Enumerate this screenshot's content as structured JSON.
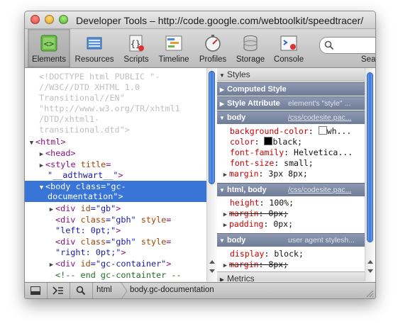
{
  "window": {
    "title": "Developer Tools – http://code.google.com/webtoolkit/speedtracer/"
  },
  "toolbar": {
    "items": [
      {
        "label": "Elements",
        "icon": "elements-icon",
        "active": true
      },
      {
        "label": "Resources",
        "icon": "resources-icon"
      },
      {
        "label": "Scripts",
        "icon": "scripts-icon"
      },
      {
        "label": "Timeline",
        "icon": "timeline-icon"
      },
      {
        "label": "Profiles",
        "icon": "profiles-icon"
      },
      {
        "label": "Storage",
        "icon": "storage-icon"
      },
      {
        "label": "Console",
        "icon": "console-icon"
      }
    ],
    "search_label": "Sea"
  },
  "dom_tree": {
    "doctype_lines": [
      "<!DOCTYPE html PUBLIC \"-",
      "//W3C//DTD XHTML 1.0",
      "Transitional//EN\"",
      "\"http://www.w3.org/TR/xhtml1",
      "/DTD/xhtml1-",
      "transitional.dtd\">"
    ],
    "html_tag": "<html>",
    "head_tag": "<head>",
    "style_tag": "<style",
    "style_attr": "title",
    "style_eq": "=",
    "style_val": "\"__adthwart__\"",
    "style_close": ">",
    "body_open": "<body",
    "body_attr": "class",
    "body_eq": "=",
    "body_val_1": "\"gc-",
    "body_val_2": "documentation\"",
    "body_close": ">",
    "div_gb_open": "<div",
    "div_gb_attr": "id",
    "div_gb_val": "=\"gb\"",
    "div_gb_close": ">",
    "div_gbh1_open": "<div",
    "div_gbh1_attr": "class",
    "div_gbh1_val": "=\"gbh\"",
    "div_gbh1_attr2": "style",
    "div_gbh1_eq2": "=",
    "div_gbh1_val2": "\"left: 0pt;\"",
    "div_gbh1_close": ">",
    "div_gbh2_open": "<div",
    "div_gbh2_attr": "class",
    "div_gbh2_val": "=\"gbh\"",
    "div_gbh2_attr2": "style",
    "div_gbh2_eq2": "=",
    "div_gbh2_val2": "\"right: 0pt;\"",
    "div_gbh2_close": ">",
    "div_gcc_open": "<div",
    "div_gcc_attr": "id",
    "div_gcc_val": "=\"gc-container\"",
    "div_gcc_close": ">",
    "comment": "<!-- end gc-containter --"
  },
  "styles_panel": {
    "header": "Styles",
    "computed_style": "Computed Style",
    "style_attribute": "Style Attribute",
    "style_attribute_note": "element's \"style\" ...",
    "rules": [
      {
        "selector": "body",
        "source": "/css/codesite.pac...",
        "props": [
          {
            "name": "background-color",
            "value": "wh...",
            "swatch": "#ffffff"
          },
          {
            "name": "color",
            "value": "black;",
            "swatch": "#000000"
          },
          {
            "name": "font-family",
            "value": "Helvetica..."
          },
          {
            "name": "font-size",
            "value": "small;"
          },
          {
            "name": "margin",
            "value": "3px 8px;",
            "expandable": true
          }
        ]
      },
      {
        "selector": "html, body",
        "source": "/css/codesite.pac...",
        "props": [
          {
            "name": "height",
            "value": "100%;"
          },
          {
            "name": "margin",
            "value": "0px;",
            "overridden": true
          },
          {
            "name": "padding",
            "value": "0px;",
            "expandable": true
          }
        ]
      },
      {
        "selector": "body",
        "source": "user agent stylesh...",
        "props": [
          {
            "name": "display",
            "value": "block;"
          },
          {
            "name": "margin",
            "value": "8px;",
            "overridden": true
          }
        ]
      }
    ],
    "metrics": "Metrics"
  },
  "statusbar": {
    "breadcrumbs": [
      "html",
      "body.gc-documentation"
    ]
  }
}
